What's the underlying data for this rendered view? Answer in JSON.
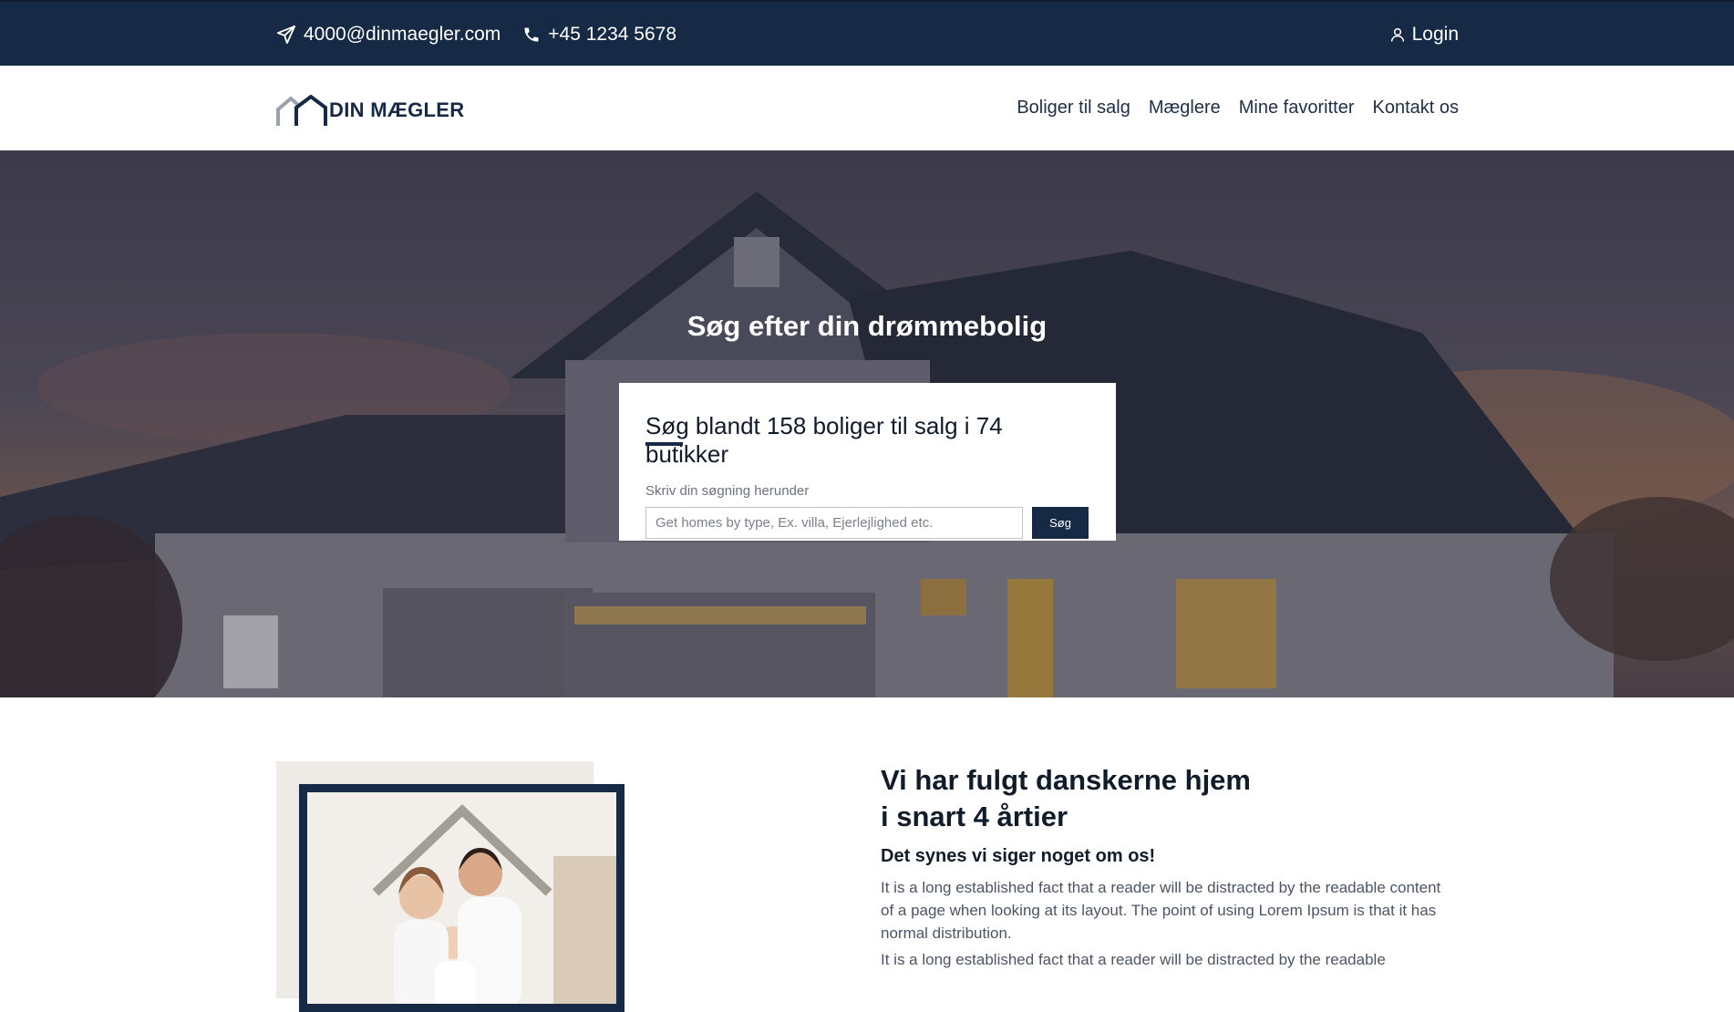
{
  "topbar": {
    "email": "4000@dinmaegler.com",
    "phone": "+45 1234 5678",
    "login_label": "Login",
    "icons": [
      "paper-plane-icon",
      "phone-icon",
      "user-icon"
    ]
  },
  "nav": {
    "logo_text": "DIN MÆGLER",
    "items": [
      "Boliger til salg",
      "Mæglere",
      "Mine favoritter",
      "Kontakt os"
    ]
  },
  "hero": {
    "title": "Søg efter din drømmebolig",
    "search": {
      "heading_highlight": "Søg",
      "heading_rest": " blandt 158 boliger til salg i 74 butikker",
      "sub": "Skriv din søgning herunder",
      "placeholder": "Get homes by type, Ex. villa, Ejerlejlighed etc.",
      "button": "Søg"
    }
  },
  "about": {
    "title_line1": "Vi har fulgt danskerne hjem",
    "title_line2": "i snart 4 årtier",
    "subtitle": "Det synes vi siger noget om os!",
    "paragraph1": "It is a long established fact that a reader will be distracted by the readable content of a page when looking at its layout. The point of using Lorem Ipsum is that it has normal distribution.",
    "paragraph2": "It is a long established fact that a reader will be distracted by the readable"
  },
  "colors": {
    "primary": "#162a45",
    "white": "#ffffff",
    "text": "#111c2b",
    "muted": "#6b7280"
  }
}
